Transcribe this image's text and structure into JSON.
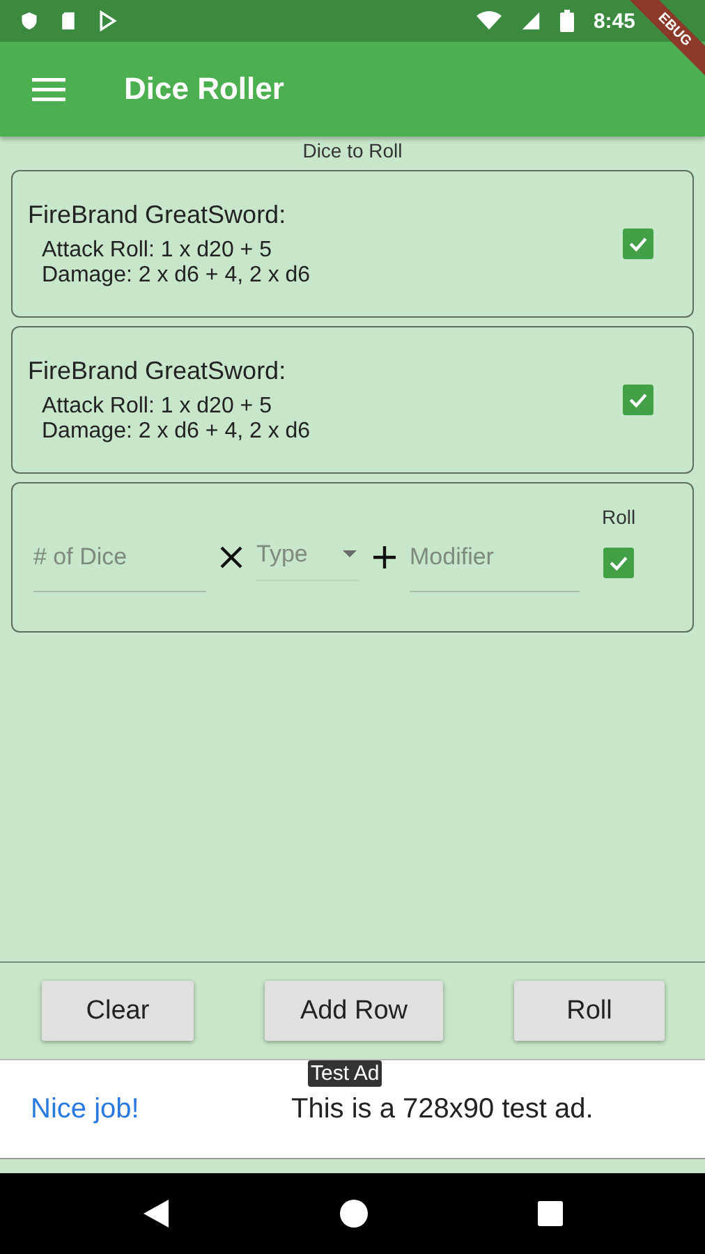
{
  "status_bar": {
    "time": "8:45"
  },
  "debug_banner": "EBUG",
  "app_bar": {
    "title": "Dice Roller"
  },
  "section_title": "Dice to Roll",
  "weapons": [
    {
      "name": "FireBrand GreatSword:",
      "lines": [
        "Attack Roll: 1 x d20 + 5",
        "Damage: 2 x d6 + 4, 2 x d6"
      ],
      "checked": true
    },
    {
      "name": "FireBrand GreatSword:",
      "lines": [
        "Attack Roll: 1 x d20 + 5",
        "Damage: 2 x d6 + 4, 2 x d6"
      ],
      "checked": true
    }
  ],
  "new_row": {
    "dice_placeholder": "# of Dice",
    "type_placeholder": "Type",
    "modifier_placeholder": "Modifier",
    "roll_label": "Roll",
    "roll_checked": true
  },
  "buttons": [
    "Clear",
    "Add Row",
    "Roll"
  ],
  "ad": {
    "badge": "Test Ad",
    "link": "Nice job!",
    "text": "This is a 728x90 test ad."
  }
}
